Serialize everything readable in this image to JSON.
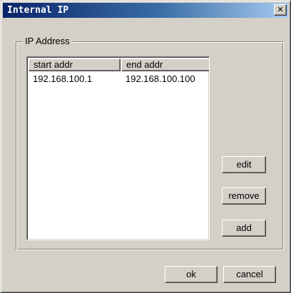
{
  "window": {
    "title": "Internal IP",
    "close_label": "✕"
  },
  "group": {
    "label": "IP Address"
  },
  "list": {
    "columns": [
      "start addr",
      "end addr"
    ],
    "rows": [
      {
        "start": "192.168.100.1",
        "end": "192.168.100.100"
      }
    ]
  },
  "buttons": {
    "edit": "edit",
    "remove": "remove",
    "add": "add",
    "ok": "ok",
    "cancel": "cancel"
  }
}
